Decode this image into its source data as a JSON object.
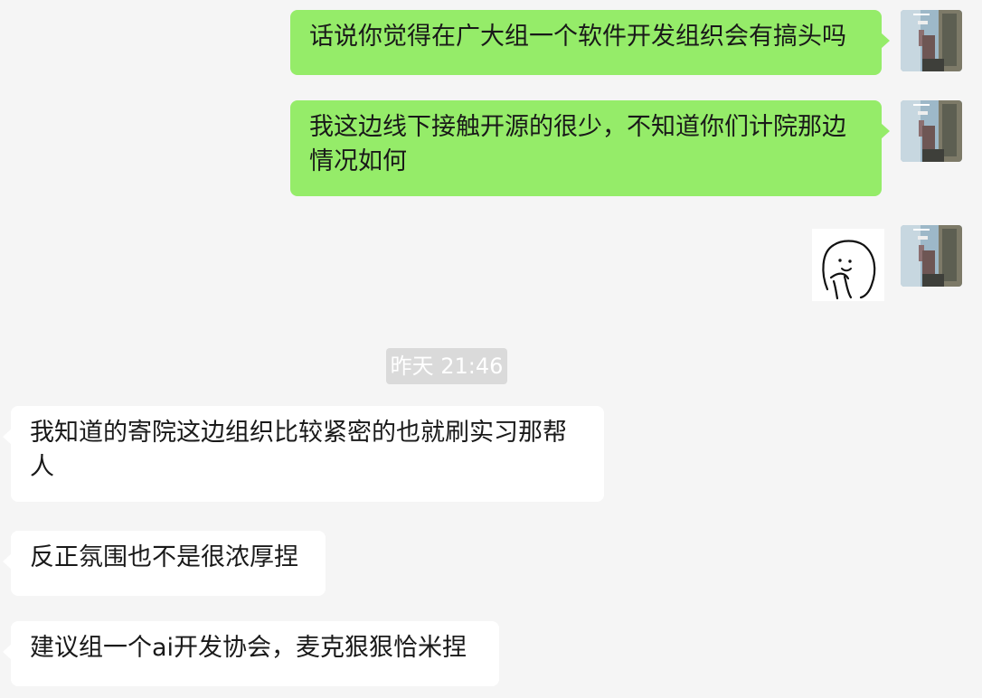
{
  "conversation": {
    "messages": [
      {
        "direction": "sent",
        "type": "text",
        "text": "话说你觉得在广大组一个软件开发组织会有搞头吗"
      },
      {
        "direction": "sent",
        "type": "text",
        "text": "我这边线下接触开源的很少，不知道你们计院那边情况如何"
      },
      {
        "direction": "sent",
        "type": "sticker"
      },
      {
        "type": "timestamp",
        "text": "昨天 21:46"
      },
      {
        "direction": "received",
        "type": "text",
        "text": "我知道的寄院这边组织比较紧密的也就刷实习那帮人"
      },
      {
        "direction": "received",
        "type": "text",
        "text": "反正氛围也不是很浓厚捏"
      },
      {
        "direction": "received",
        "type": "text",
        "text": "建议组一个ai开发协会，麦克狠狠恰米捏"
      }
    ]
  },
  "colors": {
    "background": "#f5f5f5",
    "sent_bubble": "#95ec69",
    "received_bubble": "#ffffff",
    "timestamp_background": "#dadada"
  }
}
